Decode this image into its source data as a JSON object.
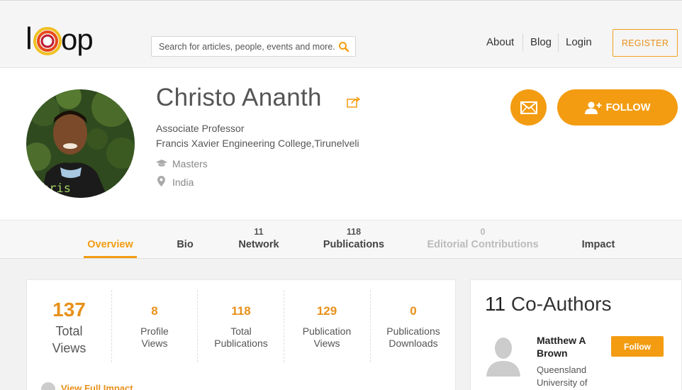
{
  "header": {
    "logo_text": "loop",
    "search_placeholder": "Search for articles, people, events and more.",
    "nav": [
      "About",
      "Blog",
      "Login"
    ],
    "register_label": "REGISTER"
  },
  "profile": {
    "name": "Christo Ananth",
    "role": "Associate Professor",
    "organization": "Francis Xavier Engineering College,Tirunelveli",
    "education": "Masters",
    "location": "India",
    "follow_label": "FOLLOW",
    "avatar_shirt_text": "hris"
  },
  "tabs": [
    {
      "label": "Overview",
      "count": "",
      "active": true
    },
    {
      "label": "Bio",
      "count": ""
    },
    {
      "label": "Network",
      "count": "11"
    },
    {
      "label": "Publications",
      "count": "118"
    },
    {
      "label": "Editorial Contributions",
      "count": "0",
      "disabled": true
    },
    {
      "label": "Impact",
      "count": ""
    }
  ],
  "stats": {
    "total_views": {
      "value": "137",
      "label_line1": "Total",
      "label_line2": "Views"
    },
    "items": [
      {
        "value": "8",
        "line1": "Profile",
        "line2": "Views"
      },
      {
        "value": "118",
        "line1": "Total",
        "line2": "Publications"
      },
      {
        "value": "129",
        "line1": "Publication",
        "line2": "Views"
      },
      {
        "value": "0",
        "line1": "Publications",
        "line2": "Downloads"
      }
    ],
    "impact_link": "View Full Impact"
  },
  "coauthors": {
    "count": "11",
    "title": "Co-Authors",
    "person": {
      "name": "Matthew A Brown",
      "affiliation": "Queensland University of",
      "follow_label": "Follow"
    }
  },
  "colors": {
    "accent": "#f39c12",
    "accent_text": "#e8901a"
  }
}
